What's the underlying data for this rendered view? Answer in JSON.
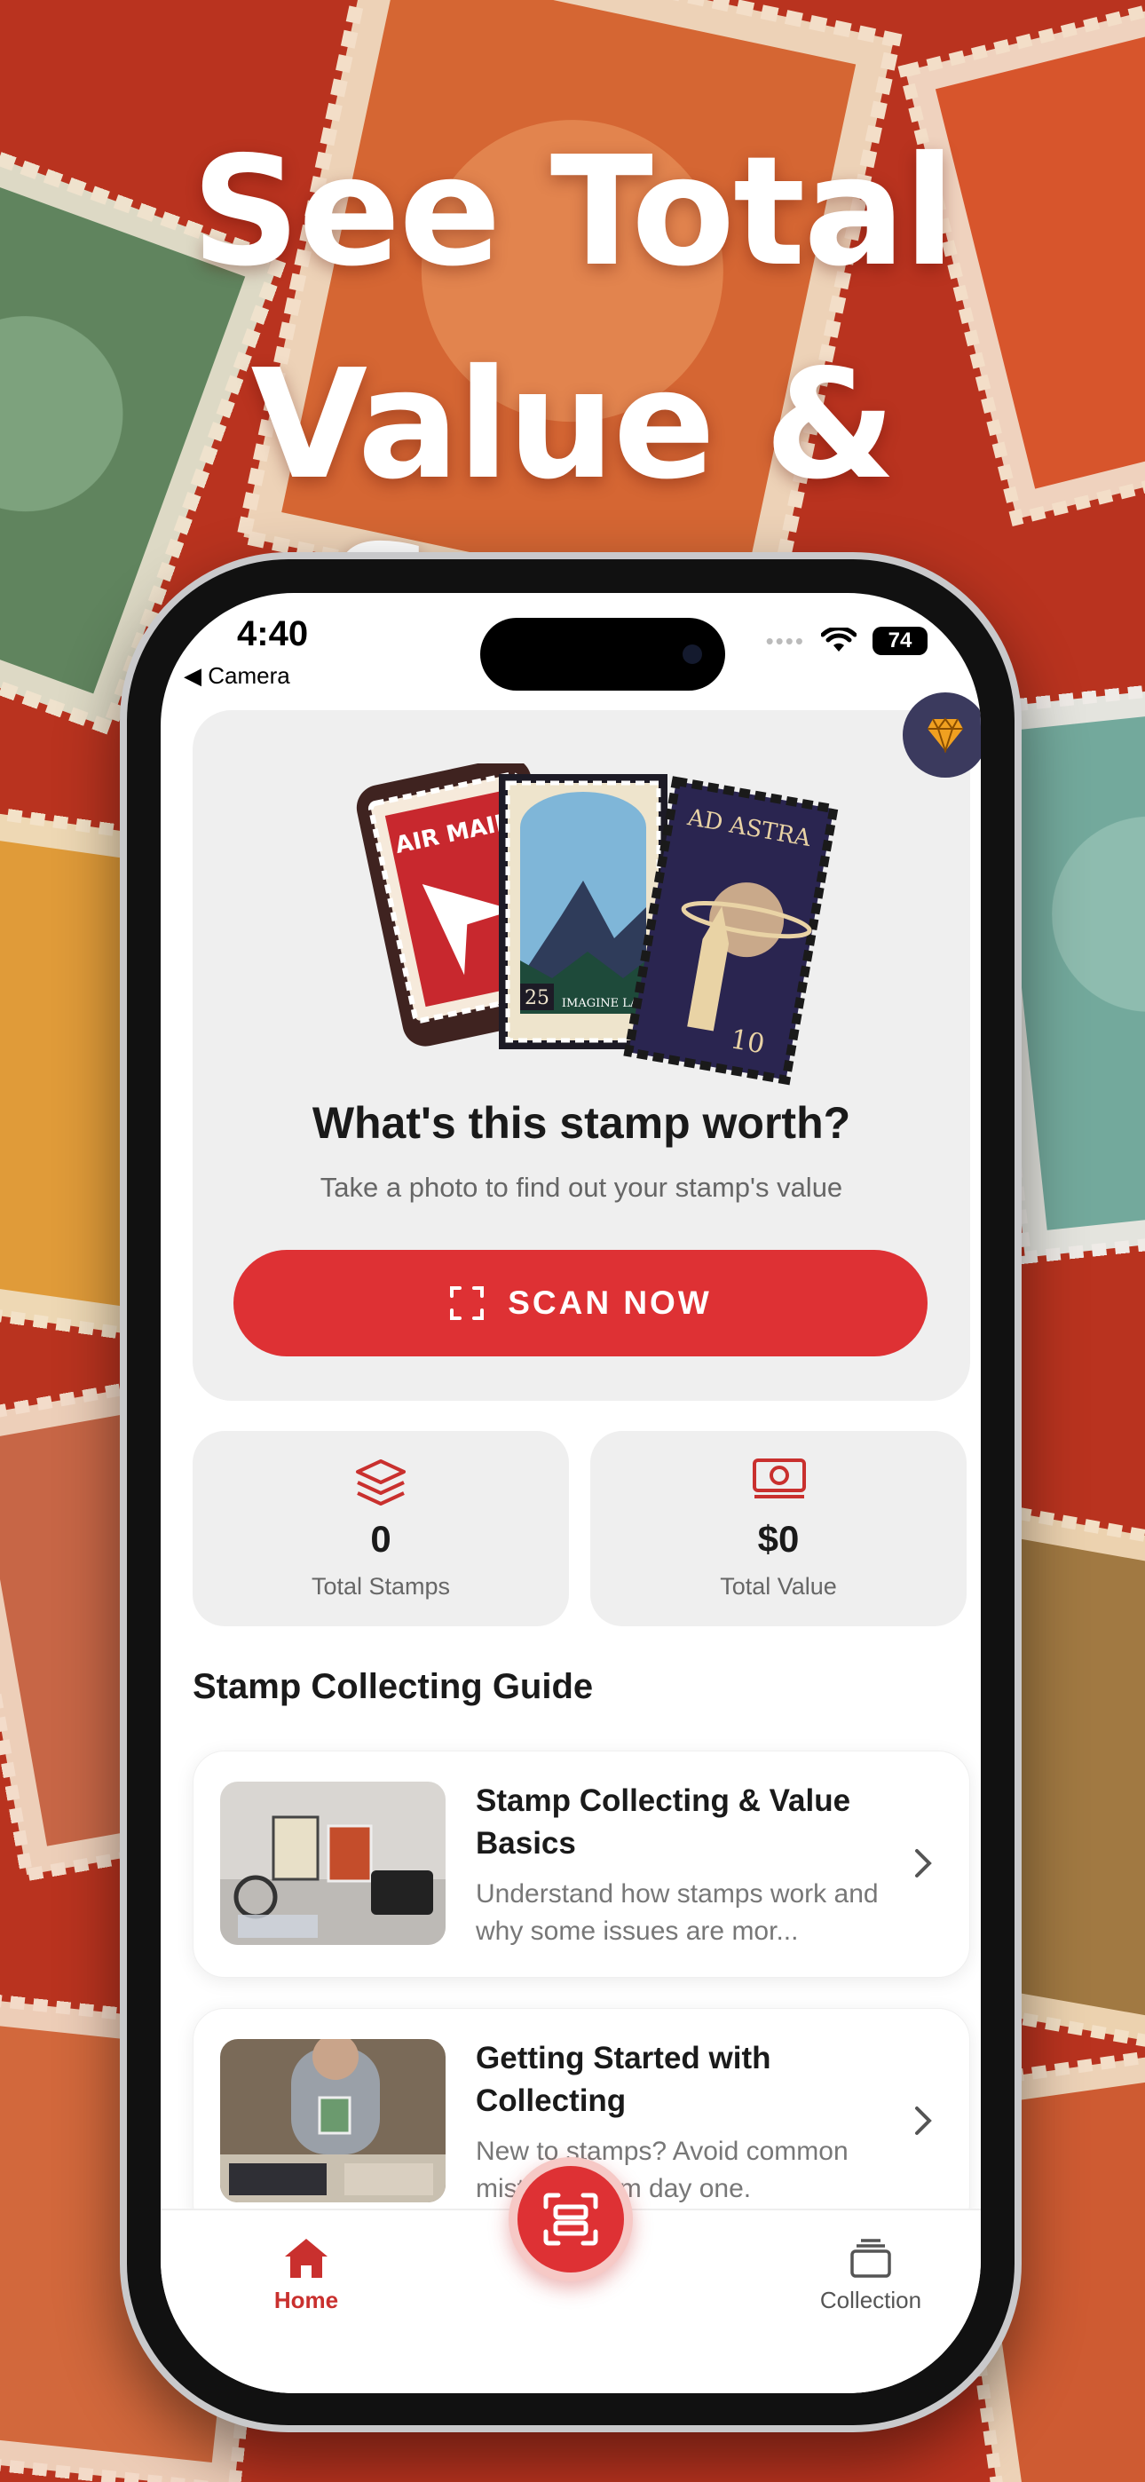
{
  "promo": {
    "headline_line1": "See Total",
    "headline_line2": "Value & Scans"
  },
  "status_bar": {
    "time": "4:40",
    "back_label": "◀ Camera",
    "battery": "74"
  },
  "hero": {
    "title": "What's this stamp worth?",
    "subtitle": "Take a photo to find out your stamp's value",
    "scan_button": "SCAN NOW",
    "stamp_texts": {
      "airmail": "AIR MAIL",
      "mountain_value": "25",
      "mountain_caption": "IMAGINE LAND",
      "rocket_header": "AD ASTRA",
      "rocket_value": "10"
    }
  },
  "stats": {
    "total_stamps_value": "0",
    "total_stamps_label": "Total Stamps",
    "total_value_value": "$0",
    "total_value_label": "Total Value"
  },
  "guide": {
    "section_title": "Stamp Collecting Guide",
    "cards": [
      {
        "title": "Stamp Collecting & Value Basics",
        "description": "Understand how stamps work and why some issues are mor..."
      },
      {
        "title": "Getting Started with Collecting",
        "description": "New to stamps? Avoid common mistakes from day one."
      }
    ]
  },
  "tabbar": {
    "home_label": "Home",
    "collection_label": "Collection"
  },
  "colors": {
    "accent_red": "#de3134",
    "premium_badge": "#3b3a5e",
    "card_bg": "#efefef"
  },
  "icons": {
    "premium": "diamond-icon",
    "scan": "scan-frame-icon",
    "stamps": "layers-icon",
    "value": "banknote-icon",
    "chevron": "chevron-right-icon",
    "home": "home-icon",
    "collection": "cards-stack-icon"
  }
}
